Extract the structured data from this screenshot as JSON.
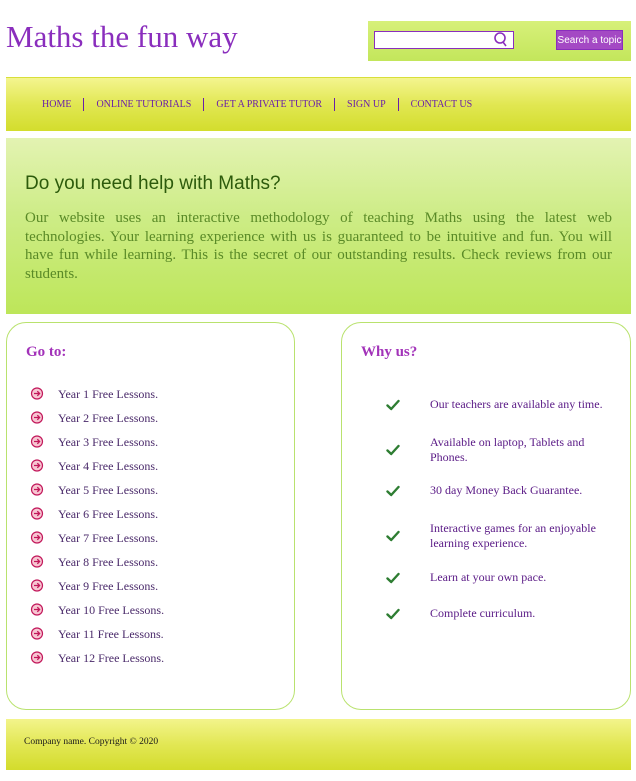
{
  "header": {
    "title": "Maths the fun way",
    "search": {
      "placeholder": "",
      "button_label": "Search a topic"
    }
  },
  "nav": {
    "items": [
      {
        "label": "HOME"
      },
      {
        "label": "ONLINE TUTORIALS"
      },
      {
        "label": "GET A PRIVATE TUTOR"
      },
      {
        "label": "SIGN UP"
      },
      {
        "label": "CONTACT US"
      }
    ]
  },
  "hero": {
    "heading": "Do you need help with Maths?",
    "text": "Our website uses an interactive methodology of teaching Maths using the latest web technologies. Your learning experience with us is guaranteed to be intuitive and fun. You will have fun while learning. This is the secret of our outstanding results. Check reviews from our students."
  },
  "goto": {
    "title": "Go to:",
    "items": [
      {
        "label": "Year 1 Free Lessons."
      },
      {
        "label": "Year 2 Free Lessons."
      },
      {
        "label": "Year 3 Free Lessons."
      },
      {
        "label": "Year 4 Free Lessons."
      },
      {
        "label": "Year 5 Free Lessons."
      },
      {
        "label": "Year 6 Free Lessons."
      },
      {
        "label": "Year 7 Free Lessons."
      },
      {
        "label": "Year 8 Free Lessons."
      },
      {
        "label": "Year 9 Free Lessons."
      },
      {
        "label": "Year 10 Free Lessons."
      },
      {
        "label": "Year 11 Free Lessons."
      },
      {
        "label": "Year 12 Free Lessons."
      }
    ]
  },
  "why": {
    "title": "Why us?",
    "items": [
      {
        "label": "Our teachers are available any time."
      },
      {
        "label": "Available on laptop, Tablets and Phones."
      },
      {
        "label": "30 day Money Back Guarantee."
      },
      {
        "label": "Interactive games for an enjoyable learning experience."
      },
      {
        "label": "Learn at your own pace."
      },
      {
        "label": "Complete curriculum."
      }
    ]
  },
  "footer": {
    "text": "Company name. Copyright © 2020"
  },
  "colors": {
    "title": "#8a2ebd",
    "accent_green": "#bde659",
    "nav_yellow": "#e1e752",
    "panel_title": "#a232b9"
  },
  "icons": {
    "search": "magnifier-icon",
    "goto_item": "arrow-circle-icon",
    "why_item": "checkmark-icon"
  }
}
